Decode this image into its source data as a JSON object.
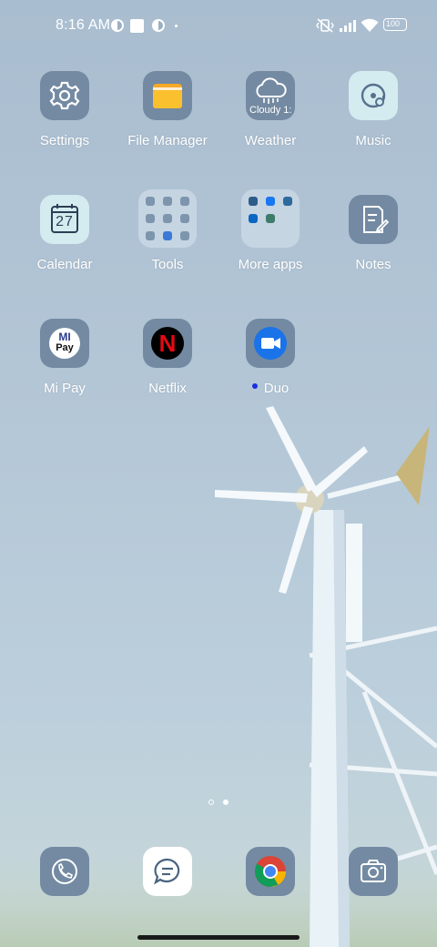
{
  "status_bar": {
    "time": "8:16 AM",
    "icons": [
      "notification-app-icon",
      "square-notification-icon",
      "notification-app-icon-2",
      "mute-vibrate-icon",
      "cellular-signal-icon",
      "wifi-icon",
      "battery-icon"
    ],
    "battery_label": "100"
  },
  "apps": [
    {
      "id": "settings",
      "label": "Settings",
      "icon": "gear-icon"
    },
    {
      "id": "file-manager",
      "label": "File Manager",
      "icon": "folder-icon"
    },
    {
      "id": "weather",
      "label": "Weather",
      "icon": "cloud-rain-icon",
      "overlay_text": "Cloudy 1:"
    },
    {
      "id": "music",
      "label": "Music",
      "icon": "music-disc-icon"
    },
    {
      "id": "calendar",
      "label": "Calendar",
      "icon": "calendar-icon",
      "day": "27"
    },
    {
      "id": "tools",
      "label": "Tools",
      "icon": "folder-grid-icon"
    },
    {
      "id": "more-apps",
      "label": "More apps",
      "icon": "folder-grid-icon"
    },
    {
      "id": "notes",
      "label": "Notes",
      "icon": "note-pencil-icon"
    },
    {
      "id": "mi-pay",
      "label": "Mi Pay",
      "icon": "mi-pay-icon",
      "logo_top": "MI",
      "logo_bottom": "Pay"
    },
    {
      "id": "netflix",
      "label": "Netflix",
      "icon": "netflix-icon",
      "logo": "N"
    },
    {
      "id": "duo",
      "label": "Duo",
      "icon": "video-camera-icon",
      "new_indicator": true
    }
  ],
  "dock": [
    {
      "id": "phone",
      "icon": "phone-icon"
    },
    {
      "id": "messages",
      "icon": "message-bubble-icon"
    },
    {
      "id": "chrome",
      "icon": "chrome-icon"
    },
    {
      "id": "camera",
      "icon": "camera-icon"
    }
  ],
  "pager": {
    "pages": 2,
    "current": 2
  },
  "colors": {
    "tile": "#738aa2",
    "accent_light": "#d4ecef",
    "new_dot": "#1a2fe0",
    "netflix_red": "#e50914"
  }
}
